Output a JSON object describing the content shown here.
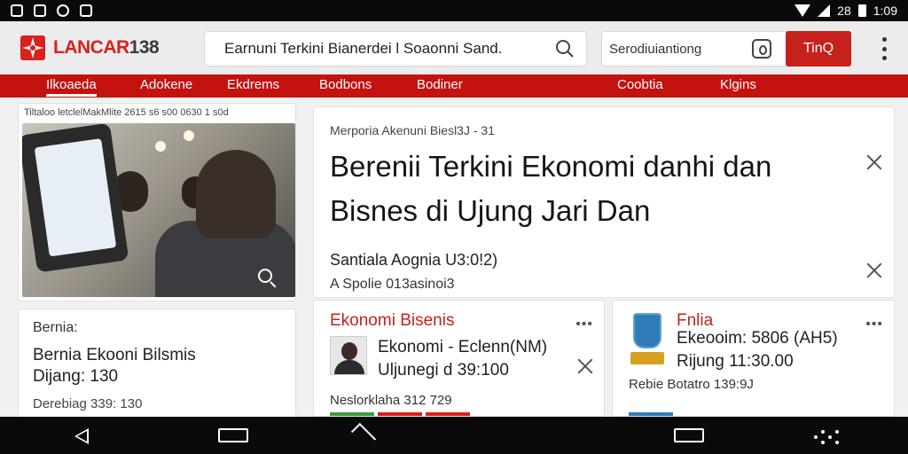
{
  "status_bar": {
    "time": "1:09",
    "indicator": "28"
  },
  "header": {
    "logo_text_red": "LANCAR",
    "logo_text_dark": "138",
    "search_main": "Earnuni Terkini Bianerdei l Soaonni Sand.",
    "search_secondary": "Serodiuiantiong",
    "search_button": "TinQ",
    "colors": {
      "brand_red": "#c4120f",
      "button_red": "#c6211c"
    }
  },
  "nav": {
    "items": [
      {
        "label": "Ilkoaeda",
        "active": true
      },
      {
        "label": "Adokene",
        "active": false
      },
      {
        "label": "Ekdrems",
        "active": false
      },
      {
        "label": "Bodbons",
        "active": false
      },
      {
        "label": "Bodiner",
        "active": false
      },
      {
        "label": "Coobtia",
        "active": false
      },
      {
        "label": "Klgins",
        "active": false
      }
    ]
  },
  "left_column": {
    "media_caption": "Tiltaloo letclelMakMlite 2615 s6 s00 0630 1 s0d",
    "mini_card": {
      "label": "Bernia:",
      "title_line1": "Bernia Ekooni Bilsmis",
      "title_line2": "Dijang: 130",
      "meta": "Derebiag 339: 130"
    }
  },
  "main_card": {
    "kicker": "Merporia Akenuni Biesl3J - 31",
    "headline": "Berenii Terkini Ekonomi danhi dan Bisnes di Ujung Jari Dan",
    "sub1": "Santiala Aognia U3:0!2)",
    "sub2": "A Spolie 013asinoi3"
  },
  "sub_cards": [
    {
      "tag": "Ekonomi Bisenis",
      "line1": "Ekonomi - Eclenn(NM)",
      "line2": "Uljunegi d 39:100",
      "foot": "Neslorklaha 312 729",
      "avatar": "person-avatar"
    },
    {
      "tag": "Fnlia",
      "line1": "Ekeooim: 5806 (AH5)",
      "line2": "Rijung 11:30.00",
      "foot": "Rebie Botatro 139:9J",
      "avatar": "trophy-icon"
    }
  ]
}
